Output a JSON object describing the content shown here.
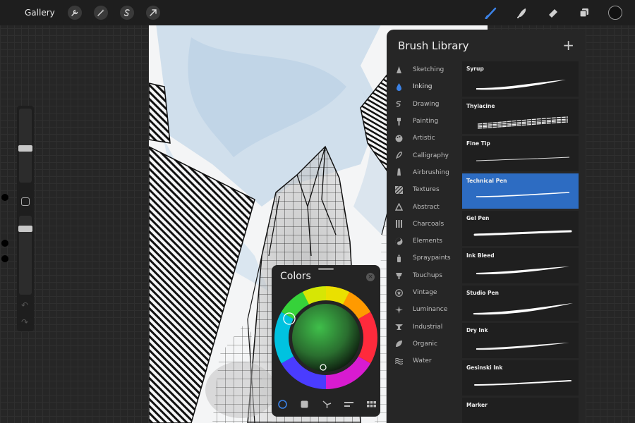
{
  "topbar": {
    "gallery_label": "Gallery",
    "left_tools": [
      "wrench-icon",
      "magic-wand-icon",
      "selection-s-icon",
      "transform-arrow-icon"
    ],
    "right_tools": [
      "brush-icon",
      "smudge-icon",
      "eraser-icon",
      "layers-icon"
    ],
    "active_color": "#111111"
  },
  "brush_library": {
    "title": "Brush Library",
    "add_label": "+",
    "categories": [
      {
        "label": "Sketching",
        "icon": "pencil-tip-icon"
      },
      {
        "label": "Inking",
        "icon": "ink-drop-icon"
      },
      {
        "label": "Drawing",
        "icon": "squiggle-icon"
      },
      {
        "label": "Painting",
        "icon": "paint-brush-icon"
      },
      {
        "label": "Artistic",
        "icon": "palette-icon"
      },
      {
        "label": "Calligraphy",
        "icon": "calligraphy-icon"
      },
      {
        "label": "Airbrushing",
        "icon": "airbrush-icon"
      },
      {
        "label": "Textures",
        "icon": "texture-icon"
      },
      {
        "label": "Abstract",
        "icon": "triangle-icon"
      },
      {
        "label": "Charcoals",
        "icon": "charcoal-icon"
      },
      {
        "label": "Elements",
        "icon": "yin-yang-icon"
      },
      {
        "label": "Spraypaints",
        "icon": "spray-can-icon"
      },
      {
        "label": "Touchups",
        "icon": "touchup-icon"
      },
      {
        "label": "Vintage",
        "icon": "star-badge-icon"
      },
      {
        "label": "Luminance",
        "icon": "sparkle-icon"
      },
      {
        "label": "Industrial",
        "icon": "anvil-icon"
      },
      {
        "label": "Organic",
        "icon": "leaf-icon"
      },
      {
        "label": "Water",
        "icon": "waves-icon"
      }
    ],
    "active_category": "Inking",
    "brushes": [
      {
        "name": "Syrup"
      },
      {
        "name": "Thylacine"
      },
      {
        "name": "Fine Tip"
      },
      {
        "name": "Technical Pen"
      },
      {
        "name": "Gel Pen"
      },
      {
        "name": "Ink Bleed"
      },
      {
        "name": "Studio Pen"
      },
      {
        "name": "Dry Ink"
      },
      {
        "name": "Gesinski Ink"
      },
      {
        "name": "Marker"
      }
    ],
    "selected_brush": "Technical Pen",
    "accent_color": "#2d6cc2"
  },
  "colors_panel": {
    "title": "Colors",
    "close_label": "×",
    "tabs": [
      "disc-icon",
      "classic-square-icon",
      "harmony-icon",
      "value-sliders-icon",
      "palettes-grid-icon"
    ],
    "active_tab": "disc-icon"
  }
}
